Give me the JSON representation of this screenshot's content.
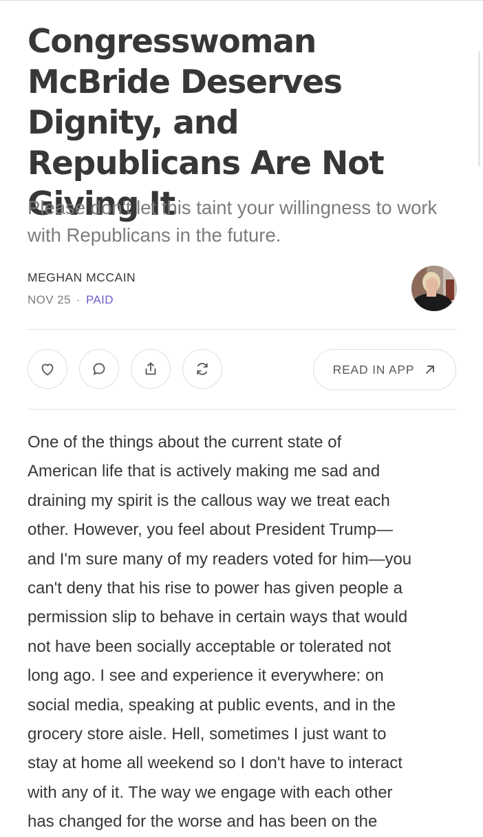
{
  "article": {
    "title": "Congresswoman McBride Deserves Dignity, and Republicans Are Not Giving It",
    "subtitle": "Please don't let this taint your willingness to work with Republicans in the future.",
    "author": "MEGHAN MCCAIN",
    "date": "NOV 25",
    "separator": "·",
    "access": "PAID",
    "access_color": "#6b5ccc"
  },
  "actions": {
    "like_icon": "heart-icon",
    "comment_icon": "comment-icon",
    "share_icon": "share-icon",
    "restack_icon": "restack-icon",
    "read_in_app_label": "READ IN APP",
    "read_in_app_icon": "arrow-up-right-icon"
  },
  "body": {
    "lines": [
      "One of the things about the current state of",
      "American life that is actively making me sad and",
      "draining my spirit is the callous way we treat each",
      "other. However, you feel about President Trump—",
      "and I'm sure many of my readers voted for him—you",
      "can't deny that his rise to power has given people a",
      "permission slip to behave in certain ways that would",
      "not have been socially acceptable or tolerated not",
      "long ago. I see and experience it everywhere: on",
      "social media, speaking at public events, and in the",
      "grocery store aisle. Hell, sometimes I just want to",
      "stay at home all weekend so I don't have to interact",
      "with any of it. The way we engage with each other",
      "has changed for the worse and has been on the"
    ]
  }
}
